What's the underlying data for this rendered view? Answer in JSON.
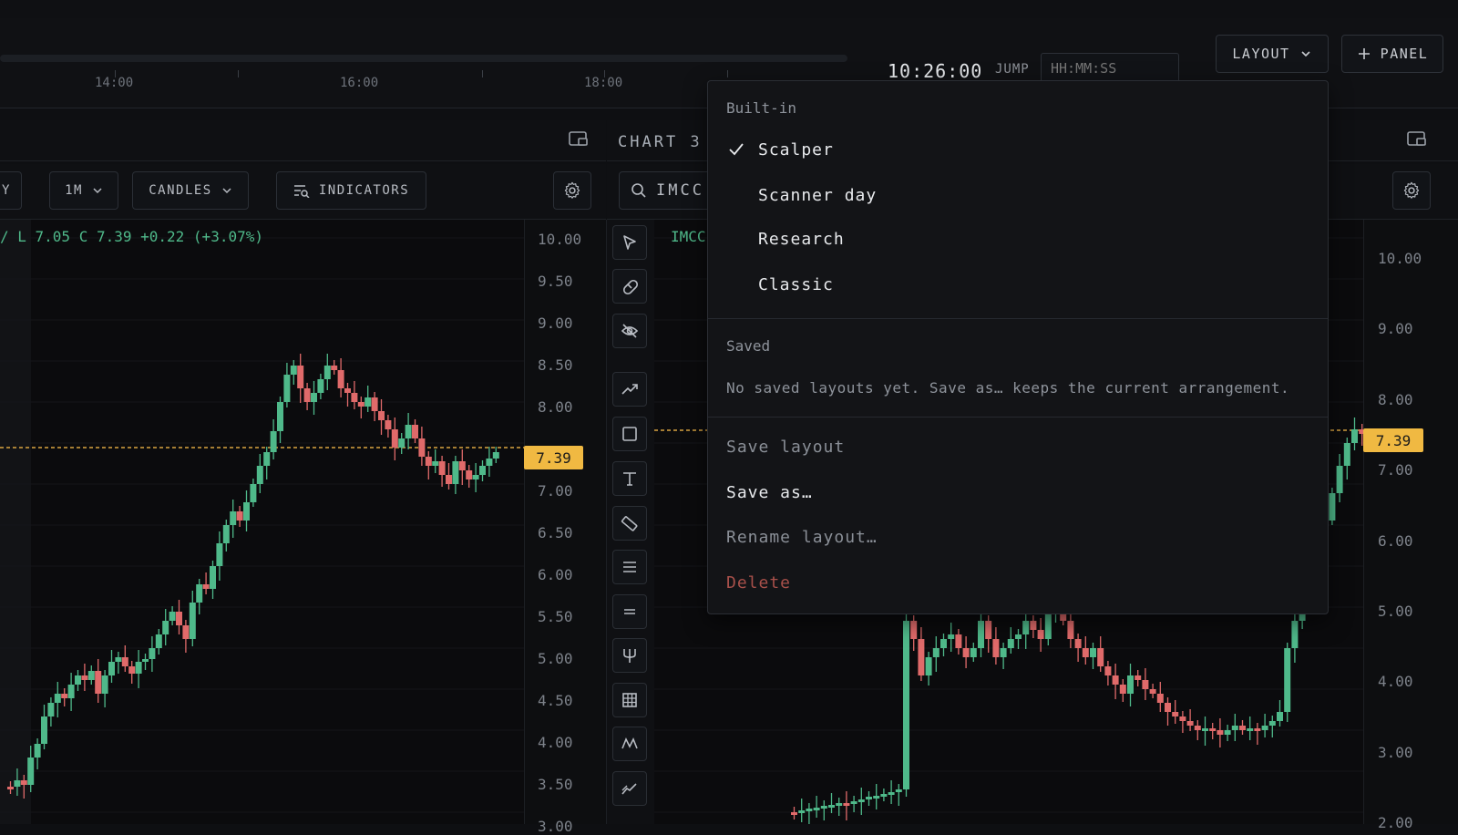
{
  "header": {
    "timeline_ticks": [
      "14:00",
      "16:00",
      "18:00"
    ],
    "clock": "10:26:00",
    "jump_label": "JUMP",
    "jump_placeholder": "HH:MM:SS",
    "layout_label": "LAYOUT",
    "panel_label": "PANEL"
  },
  "left_panel": {
    "toolbar": {
      "cut_label": "Y",
      "interval": "1M",
      "chart_type": "CANDLES",
      "indicators_label": "INDICATORS"
    },
    "ohlc": "/ L 7.05 C 7.39 +0.22 (+3.07%)",
    "price_labels": [
      "10.00",
      "9.50",
      "9.00",
      "8.50",
      "8.00",
      "7.00",
      "6.50",
      "6.00",
      "5.50",
      "5.00",
      "4.50",
      "4.00",
      "3.50",
      "3.00"
    ],
    "last_price": "7.39"
  },
  "right_panel": {
    "title": "CHART 3",
    "search_value": "IMCC",
    "symbol_label": "IMCC",
    "price_labels": [
      "10.00",
      "9.00",
      "8.00",
      "7.00",
      "6.00",
      "5.00",
      "4.00",
      "3.00",
      "2.00"
    ],
    "last_price": "7.39"
  },
  "drawing_tools": [
    "cursor-icon",
    "magnet-icon",
    "eye-off-icon",
    "trend-line-icon",
    "rectangle-icon",
    "text-icon",
    "ruler-icon",
    "horizontal-lines-icon",
    "parallel-lines-icon",
    "pitchfork-icon",
    "grid-icon",
    "zigzag-icon",
    "path-icon"
  ],
  "layout_menu": {
    "builtin_title": "Built-in",
    "builtin_items": [
      {
        "label": "Scalper",
        "checked": true
      },
      {
        "label": "Scanner day",
        "checked": false
      },
      {
        "label": "Research",
        "checked": false
      },
      {
        "label": "Classic",
        "checked": false
      }
    ],
    "saved_title": "Saved",
    "saved_empty": "No saved layouts yet. Save as… keeps the current arrangement.",
    "save_layout": "Save layout",
    "save_as": "Save as…",
    "rename_layout": "Rename layout…",
    "delete": "Delete"
  },
  "colors": {
    "up": "#4fb98a",
    "down": "#e06a6a",
    "price_tag": "#f0b942",
    "background": "#0e0f12"
  }
}
